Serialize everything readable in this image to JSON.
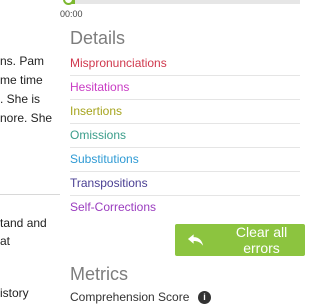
{
  "reader": {
    "lines": [
      "ns. Pam",
      "me time",
      ". She is",
      "nore. She",
      "tand and",
      "at",
      "istory"
    ]
  },
  "player": {
    "time": "00:00",
    "progress_fraction": 0.02
  },
  "details": {
    "heading": "Details",
    "items": [
      {
        "label": "Mispronunciations",
        "color": "#d0384d"
      },
      {
        "label": "Hesitations",
        "color": "#c93cc4"
      },
      {
        "label": "Insertions",
        "color": "#a6a41d"
      },
      {
        "label": "Omissions",
        "color": "#3a9d8a"
      },
      {
        "label": "Substitutions",
        "color": "#2e9ad4"
      },
      {
        "label": "Transpositions",
        "color": "#4a3f93"
      },
      {
        "label": "Self-Corrections",
        "color": "#9a3cbf"
      }
    ]
  },
  "clear_button": {
    "label": "Clear all errors",
    "icon": "undo-arrow-icon",
    "color": "#8cc43f"
  },
  "metrics": {
    "heading": "Metrics",
    "first_row": "Comprehension Score"
  }
}
